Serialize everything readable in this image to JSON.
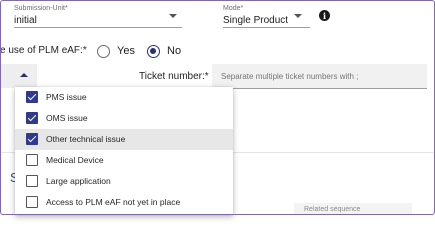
{
  "submission_unit": {
    "label": "Submission-Unit*",
    "value": "initial"
  },
  "mode": {
    "label": "Mode*",
    "value": "Single Product"
  },
  "question": {
    "label": "e use of PLM eAF:*"
  },
  "radio": {
    "yes_label": "Yes",
    "no_label": "No",
    "selected": "No"
  },
  "ticket": {
    "label": "Ticket number:*",
    "placeholder": "Separate multiple ticket numbers with ;"
  },
  "options": [
    {
      "label": "PMS issue",
      "checked": true
    },
    {
      "label": "OMS issue",
      "checked": true
    },
    {
      "label": "Other technical issue",
      "checked": true
    },
    {
      "label": "Medical Device",
      "checked": false
    },
    {
      "label": "Large application",
      "checked": false
    },
    {
      "label": "Access to PLM eAF not yet in place",
      "checked": false
    }
  ],
  "background": {
    "section_letter": "S",
    "related_label": "Related sequence"
  }
}
